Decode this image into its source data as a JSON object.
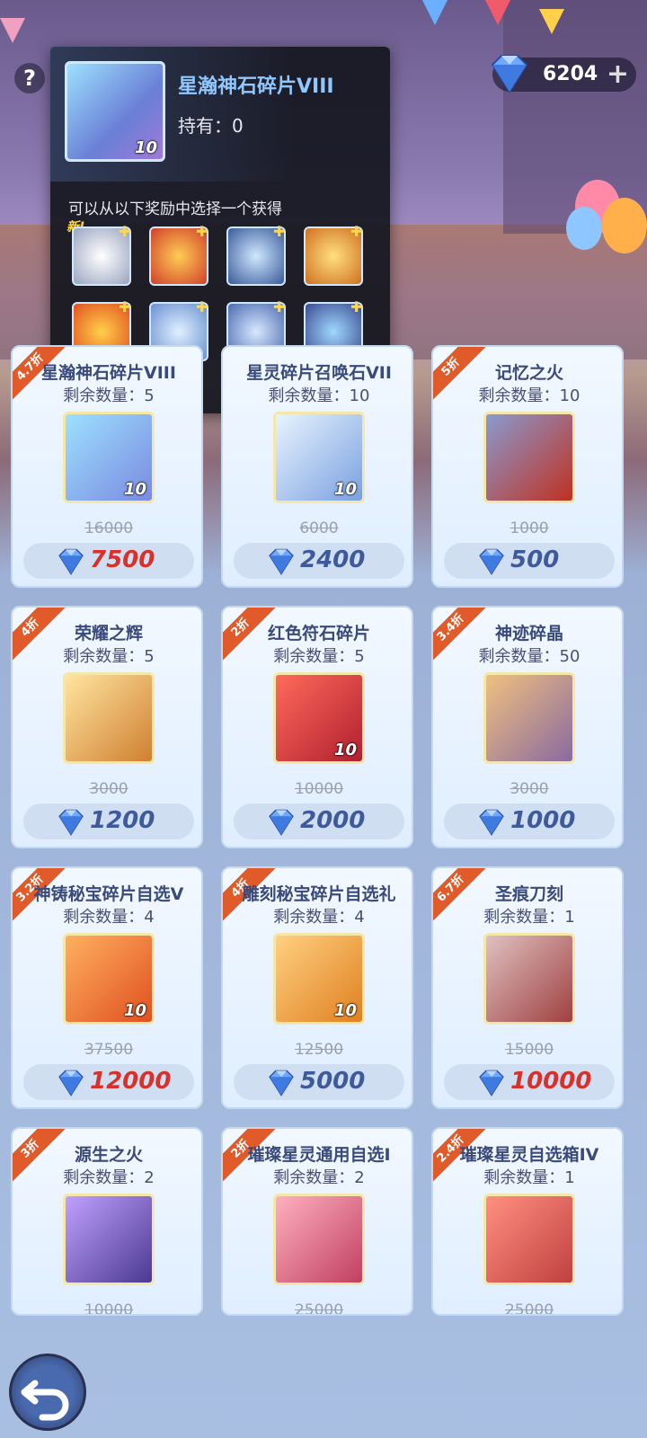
{
  "help": {
    "label": "?"
  },
  "currency": {
    "amount": "6204",
    "plus": "+",
    "icon": "diamond-icon"
  },
  "popup": {
    "title": "星瀚神石碎片VIII",
    "owned": "持有：0",
    "qty": "10",
    "description": "可以从以下奖励中选择一个获得",
    "new_tag": "新!",
    "reward_count": 9
  },
  "shop": {
    "items": [
      {
        "discount": "4.7折",
        "name": "星瀚神石碎片VIII",
        "stock": "剩余数量：5",
        "qty": "10",
        "old_price": "16000",
        "price": "7500",
        "price_color": "red"
      },
      {
        "discount": "",
        "name": "星灵碎片召唤石VII",
        "stock": "剩余数量：10",
        "qty": "10",
        "old_price": "6000",
        "price": "2400",
        "price_color": "blue"
      },
      {
        "discount": "5折",
        "name": "记忆之火",
        "stock": "剩余数量：10",
        "qty": "",
        "old_price": "1000",
        "price": "500",
        "price_color": "blue"
      },
      {
        "discount": "4折",
        "name": "荣耀之辉",
        "stock": "剩余数量：5",
        "qty": "",
        "old_price": "3000",
        "price": "1200",
        "price_color": "blue"
      },
      {
        "discount": "2折",
        "name": "红色符石碎片",
        "stock": "剩余数量：5",
        "qty": "10",
        "old_price": "10000",
        "price": "2000",
        "price_color": "blue"
      },
      {
        "discount": "3.4折",
        "name": "神迹碎晶",
        "stock": "剩余数量：50",
        "qty": "",
        "old_price": "3000",
        "price": "1000",
        "price_color": "blue"
      },
      {
        "discount": "3.2折",
        "name": "神铸秘宝碎片自选V",
        "stock": "剩余数量：4",
        "qty": "10",
        "old_price": "37500",
        "price": "12000",
        "price_color": "red"
      },
      {
        "discount": "4折",
        "name": "雕刻秘宝碎片自选礼",
        "stock": "剩余数量：4",
        "qty": "10",
        "old_price": "12500",
        "price": "5000",
        "price_color": "blue"
      },
      {
        "discount": "6.7折",
        "name": "圣痕刀刻",
        "stock": "剩余数量：1",
        "qty": "",
        "old_price": "15000",
        "price": "10000",
        "price_color": "red"
      },
      {
        "discount": "3折",
        "name": "源生之火",
        "stock": "剩余数量：2",
        "qty": "",
        "old_price": "10000",
        "price": "",
        "price_color": "blue"
      },
      {
        "discount": "2折",
        "name": "璀璨星灵通用自选I",
        "stock": "剩余数量：2",
        "qty": "",
        "old_price": "25000",
        "price": "",
        "price_color": "blue"
      },
      {
        "discount": "2.4折",
        "name": "璀璨星灵自选箱IV",
        "stock": "剩余数量：1",
        "qty": "",
        "old_price": "25000",
        "price": "",
        "price_color": "blue"
      }
    ]
  },
  "back_button": {
    "icon": "back-arrow-icon"
  }
}
